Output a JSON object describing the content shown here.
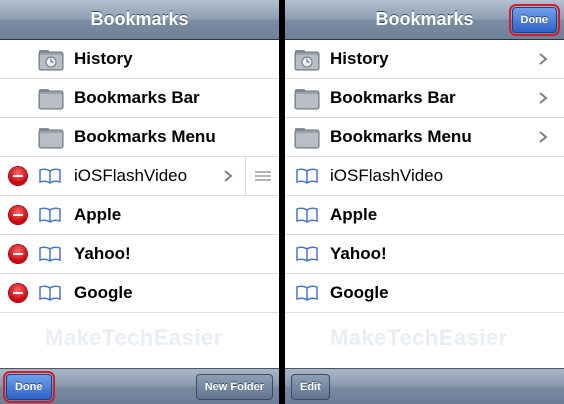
{
  "left_panel": {
    "title": "Bookmarks",
    "rows": [
      {
        "label": "History"
      },
      {
        "label": "Bookmarks Bar"
      },
      {
        "label": "Bookmarks Menu"
      },
      {
        "label": "iOSFlashVideo"
      },
      {
        "label": "Apple"
      },
      {
        "label": "Yahoo!"
      },
      {
        "label": "Google"
      }
    ],
    "watermark": "MakeTechEasier",
    "toolbar": {
      "done_label": "Done",
      "new_folder_label": "New Folder"
    }
  },
  "right_panel": {
    "title": "Bookmarks",
    "done_label": "Done",
    "rows": [
      {
        "label": "History"
      },
      {
        "label": "Bookmarks Bar"
      },
      {
        "label": "Bookmarks Menu"
      },
      {
        "label": "iOSFlashVideo"
      },
      {
        "label": "Apple"
      },
      {
        "label": "Yahoo!"
      },
      {
        "label": "Google"
      }
    ],
    "watermark": "MakeTechEasier",
    "toolbar": {
      "edit_label": "Edit"
    }
  },
  "colors": {
    "highlight": "#d11e2e",
    "done_button": "#2e62c6",
    "bar": "#7b8ca4"
  },
  "icons": [
    "folder-icon",
    "history-icon",
    "bookmark-book-icon",
    "delete-icon",
    "chevron-right-icon",
    "reorder-icon"
  ]
}
